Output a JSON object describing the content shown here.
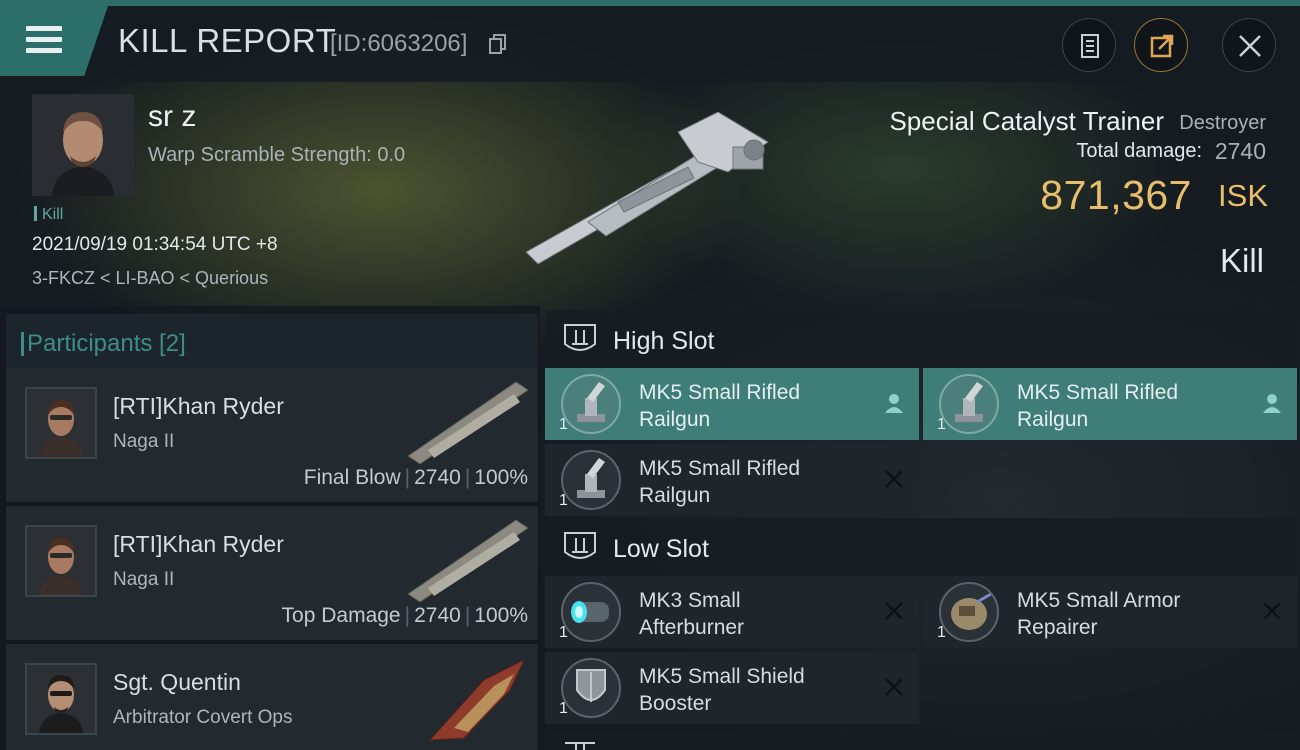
{
  "header": {
    "title": "KILL REPORT",
    "report_id": "[ID:6063206]",
    "buttons": [
      "clipboard-icon",
      "share-icon",
      "close-icon"
    ]
  },
  "victim": {
    "name": "sr z",
    "warp_scramble": "Warp Scramble Strength: 0.0",
    "tag": "Kill",
    "time": "2021/09/19 01:34:54 UTC +8",
    "location": "3-FKCZ < LI-BAO < Querious"
  },
  "ship": {
    "name": "Special Catalyst Trainer",
    "class": "Destroyer",
    "total_damage_label": "Total damage:",
    "total_damage": "2740",
    "isk_value": "871,367",
    "isk_unit": "ISK",
    "result": "Kill"
  },
  "participants": {
    "header": "Participants [2]",
    "items": [
      {
        "name": "[RTI]Khan Ryder",
        "ship": "Naga II",
        "role": "Final Blow",
        "damage": "2740",
        "percent": "100%"
      },
      {
        "name": "[RTI]Khan Ryder",
        "ship": "Naga II",
        "role": "Top Damage",
        "damage": "2740",
        "percent": "100%"
      },
      {
        "name": "Sgt. Quentin",
        "ship": "Arbitrator Covert Ops"
      }
    ]
  },
  "fitting": {
    "high_slot": {
      "label": "High Slot",
      "modules": [
        {
          "name": "MK5 Small Rifled Railgun",
          "qty": "1",
          "status": "dropped"
        },
        {
          "name": "MK5 Small Rifled Railgun",
          "qty": "1",
          "status": "dropped"
        },
        {
          "name": "MK5 Small Rifled Railgun",
          "qty": "1",
          "status": "destroyed"
        }
      ]
    },
    "low_slot": {
      "label": "Low Slot",
      "modules": [
        {
          "name": "MK3 Small Afterburner",
          "qty": "1",
          "status": "destroyed"
        },
        {
          "name": "MK5 Small Armor Repairer",
          "qty": "1",
          "status": "destroyed"
        },
        {
          "name": "MK5 Small Shield Booster",
          "qty": "1",
          "status": "destroyed"
        }
      ]
    }
  },
  "colors": {
    "accent": "#3e7d78",
    "isk": "#e8bd6c",
    "header_bar": "#2c6f6a"
  }
}
